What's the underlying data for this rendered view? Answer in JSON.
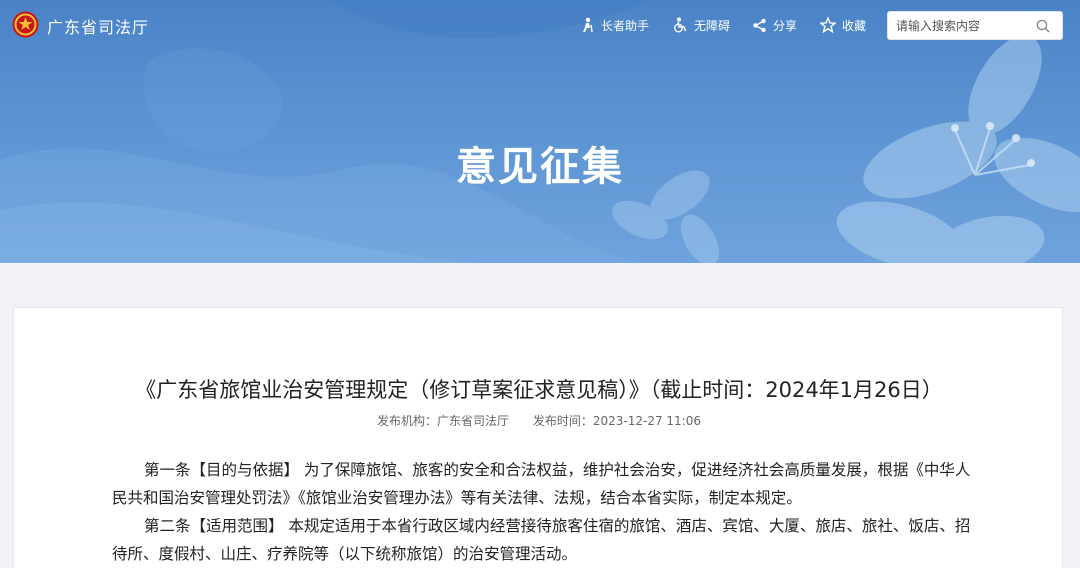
{
  "header": {
    "site_name": "广东省司法厅",
    "logo_icon": "national-emblem-icon",
    "tools": [
      {
        "label": "长者助手",
        "icon": "elder-assistant-icon"
      },
      {
        "label": "无障碍",
        "icon": "wheelchair-icon"
      },
      {
        "label": "分享",
        "icon": "share-icon"
      },
      {
        "label": "收藏",
        "icon": "star-icon"
      }
    ],
    "search": {
      "placeholder": "请输入搜索内容",
      "value": "",
      "icon": "search-icon"
    }
  },
  "hero": {
    "title": "意见征集"
  },
  "article": {
    "title": "《广东省旅馆业治安管理规定（修订草案征求意见稿）》（截止时间：2024年1月26日）",
    "publisher": "发布机构：广东省司法厅",
    "publish_time": "发布时间：2023-12-27 11:06",
    "paragraphs": [
      "第一条【目的与依据】 为了保障旅馆、旅客的安全和合法权益，维护社会治安，促进经济社会高质量发展，根据《中华人民共和国治安管理处罚法》《旅馆业治安管理办法》等有关法律、法规，结合本省实际，制定本规定。",
      "第二条【适用范围】 本规定适用于本省行政区域内经营接待旅客住宿的旅馆、酒店、宾馆、大厦、旅店、旅社、饭店、招待所、度假村、山庄、疗养院等（以下统称旅馆）的治安管理活动。"
    ]
  },
  "colors": {
    "hero_blue": "#4a83c6",
    "card_bg": "#ffffff",
    "page_bg": "#f1f3f6"
  }
}
